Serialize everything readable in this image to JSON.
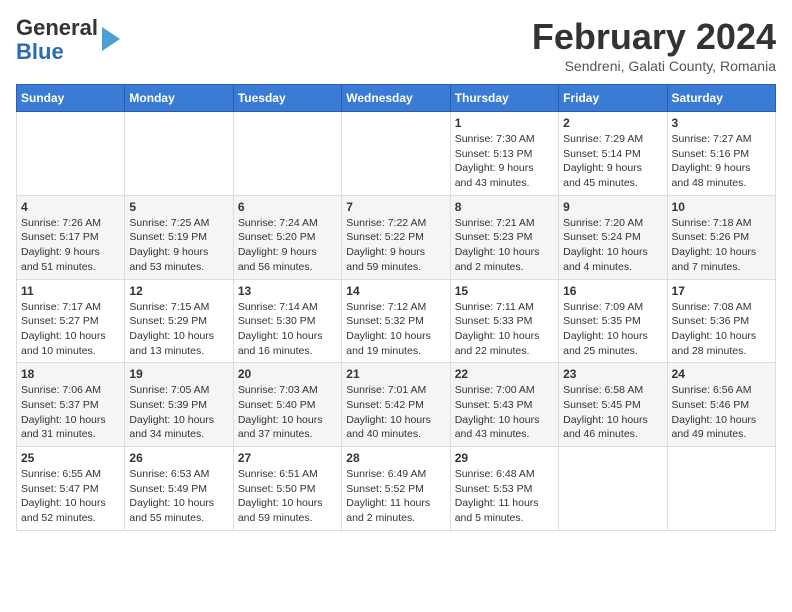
{
  "header": {
    "logo_line1": "General",
    "logo_line2": "Blue",
    "month_title": "February 2024",
    "location": "Sendreni, Galati County, Romania"
  },
  "columns": [
    "Sunday",
    "Monday",
    "Tuesday",
    "Wednesday",
    "Thursday",
    "Friday",
    "Saturday"
  ],
  "weeks": [
    [
      {
        "day": "",
        "info": ""
      },
      {
        "day": "",
        "info": ""
      },
      {
        "day": "",
        "info": ""
      },
      {
        "day": "",
        "info": ""
      },
      {
        "day": "1",
        "info": "Sunrise: 7:30 AM\nSunset: 5:13 PM\nDaylight: 9 hours\nand 43 minutes."
      },
      {
        "day": "2",
        "info": "Sunrise: 7:29 AM\nSunset: 5:14 PM\nDaylight: 9 hours\nand 45 minutes."
      },
      {
        "day": "3",
        "info": "Sunrise: 7:27 AM\nSunset: 5:16 PM\nDaylight: 9 hours\nand 48 minutes."
      }
    ],
    [
      {
        "day": "4",
        "info": "Sunrise: 7:26 AM\nSunset: 5:17 PM\nDaylight: 9 hours\nand 51 minutes."
      },
      {
        "day": "5",
        "info": "Sunrise: 7:25 AM\nSunset: 5:19 PM\nDaylight: 9 hours\nand 53 minutes."
      },
      {
        "day": "6",
        "info": "Sunrise: 7:24 AM\nSunset: 5:20 PM\nDaylight: 9 hours\nand 56 minutes."
      },
      {
        "day": "7",
        "info": "Sunrise: 7:22 AM\nSunset: 5:22 PM\nDaylight: 9 hours\nand 59 minutes."
      },
      {
        "day": "8",
        "info": "Sunrise: 7:21 AM\nSunset: 5:23 PM\nDaylight: 10 hours\nand 2 minutes."
      },
      {
        "day": "9",
        "info": "Sunrise: 7:20 AM\nSunset: 5:24 PM\nDaylight: 10 hours\nand 4 minutes."
      },
      {
        "day": "10",
        "info": "Sunrise: 7:18 AM\nSunset: 5:26 PM\nDaylight: 10 hours\nand 7 minutes."
      }
    ],
    [
      {
        "day": "11",
        "info": "Sunrise: 7:17 AM\nSunset: 5:27 PM\nDaylight: 10 hours\nand 10 minutes."
      },
      {
        "day": "12",
        "info": "Sunrise: 7:15 AM\nSunset: 5:29 PM\nDaylight: 10 hours\nand 13 minutes."
      },
      {
        "day": "13",
        "info": "Sunrise: 7:14 AM\nSunset: 5:30 PM\nDaylight: 10 hours\nand 16 minutes."
      },
      {
        "day": "14",
        "info": "Sunrise: 7:12 AM\nSunset: 5:32 PM\nDaylight: 10 hours\nand 19 minutes."
      },
      {
        "day": "15",
        "info": "Sunrise: 7:11 AM\nSunset: 5:33 PM\nDaylight: 10 hours\nand 22 minutes."
      },
      {
        "day": "16",
        "info": "Sunrise: 7:09 AM\nSunset: 5:35 PM\nDaylight: 10 hours\nand 25 minutes."
      },
      {
        "day": "17",
        "info": "Sunrise: 7:08 AM\nSunset: 5:36 PM\nDaylight: 10 hours\nand 28 minutes."
      }
    ],
    [
      {
        "day": "18",
        "info": "Sunrise: 7:06 AM\nSunset: 5:37 PM\nDaylight: 10 hours\nand 31 minutes."
      },
      {
        "day": "19",
        "info": "Sunrise: 7:05 AM\nSunset: 5:39 PM\nDaylight: 10 hours\nand 34 minutes."
      },
      {
        "day": "20",
        "info": "Sunrise: 7:03 AM\nSunset: 5:40 PM\nDaylight: 10 hours\nand 37 minutes."
      },
      {
        "day": "21",
        "info": "Sunrise: 7:01 AM\nSunset: 5:42 PM\nDaylight: 10 hours\nand 40 minutes."
      },
      {
        "day": "22",
        "info": "Sunrise: 7:00 AM\nSunset: 5:43 PM\nDaylight: 10 hours\nand 43 minutes."
      },
      {
        "day": "23",
        "info": "Sunrise: 6:58 AM\nSunset: 5:45 PM\nDaylight: 10 hours\nand 46 minutes."
      },
      {
        "day": "24",
        "info": "Sunrise: 6:56 AM\nSunset: 5:46 PM\nDaylight: 10 hours\nand 49 minutes."
      }
    ],
    [
      {
        "day": "25",
        "info": "Sunrise: 6:55 AM\nSunset: 5:47 PM\nDaylight: 10 hours\nand 52 minutes."
      },
      {
        "day": "26",
        "info": "Sunrise: 6:53 AM\nSunset: 5:49 PM\nDaylight: 10 hours\nand 55 minutes."
      },
      {
        "day": "27",
        "info": "Sunrise: 6:51 AM\nSunset: 5:50 PM\nDaylight: 10 hours\nand 59 minutes."
      },
      {
        "day": "28",
        "info": "Sunrise: 6:49 AM\nSunset: 5:52 PM\nDaylight: 11 hours\nand 2 minutes."
      },
      {
        "day": "29",
        "info": "Sunrise: 6:48 AM\nSunset: 5:53 PM\nDaylight: 11 hours\nand 5 minutes."
      },
      {
        "day": "",
        "info": ""
      },
      {
        "day": "",
        "info": ""
      }
    ]
  ]
}
